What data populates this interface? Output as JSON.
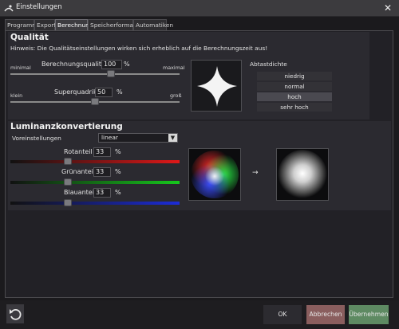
{
  "window": {
    "title": "Einstellungen",
    "app_icon": "app-logo-icon",
    "close_icon": "close-icon"
  },
  "tabs": [
    {
      "label": "Programm"
    },
    {
      "label": "Export"
    },
    {
      "label": "Berechnung"
    },
    {
      "label": "Speicherformate"
    },
    {
      "label": "Automatiken"
    }
  ],
  "active_tab": "Berechnung",
  "qualitaet": {
    "title": "Qualität",
    "hint": "Hinweis: Die Qualitätseinstellungen wirken sich erheblich auf die Berechnungszeit aus!",
    "berechnungsqualitaet": {
      "min_label": "minimal",
      "label": "Berechnungsqualität",
      "value": "100",
      "unit": "%",
      "max_label": "maximal",
      "level": 0.6
    },
    "superquadrik": {
      "min_label": "klein",
      "label": "Superquadrik",
      "value": "50",
      "unit": "%",
      "max_label": "groß",
      "level": 0.5
    },
    "abtastdichte": {
      "label": "Abtastdichte",
      "options": [
        "niedrig",
        "normal",
        "hoch",
        "sehr hoch"
      ],
      "selected": "hoch"
    }
  },
  "luminanz": {
    "title": "Luminanzkonvertierung",
    "voreinstellungen": {
      "label": "Voreinstellungen",
      "value": "linear"
    },
    "rotanteil": {
      "label": "Rotanteil",
      "value": "33",
      "unit": "%",
      "level": 0.33,
      "color": "#e01818"
    },
    "gruenanteil": {
      "label": "Grünanteil",
      "value": "33",
      "unit": "%",
      "level": 0.33,
      "color": "#16c81c"
    },
    "blauanteil": {
      "label": "Blauanteil",
      "value": "33",
      "unit": "%",
      "level": 0.33,
      "color": "#1c2cd8"
    },
    "arrow": "→"
  },
  "footer": {
    "reset_icon": "undo-icon",
    "ok_label": "OK",
    "cancel_label": "Abbrechen",
    "apply_label": "Übernehmen",
    "cancel_color": "#8a5e5e",
    "apply_color": "#5e8a62"
  }
}
